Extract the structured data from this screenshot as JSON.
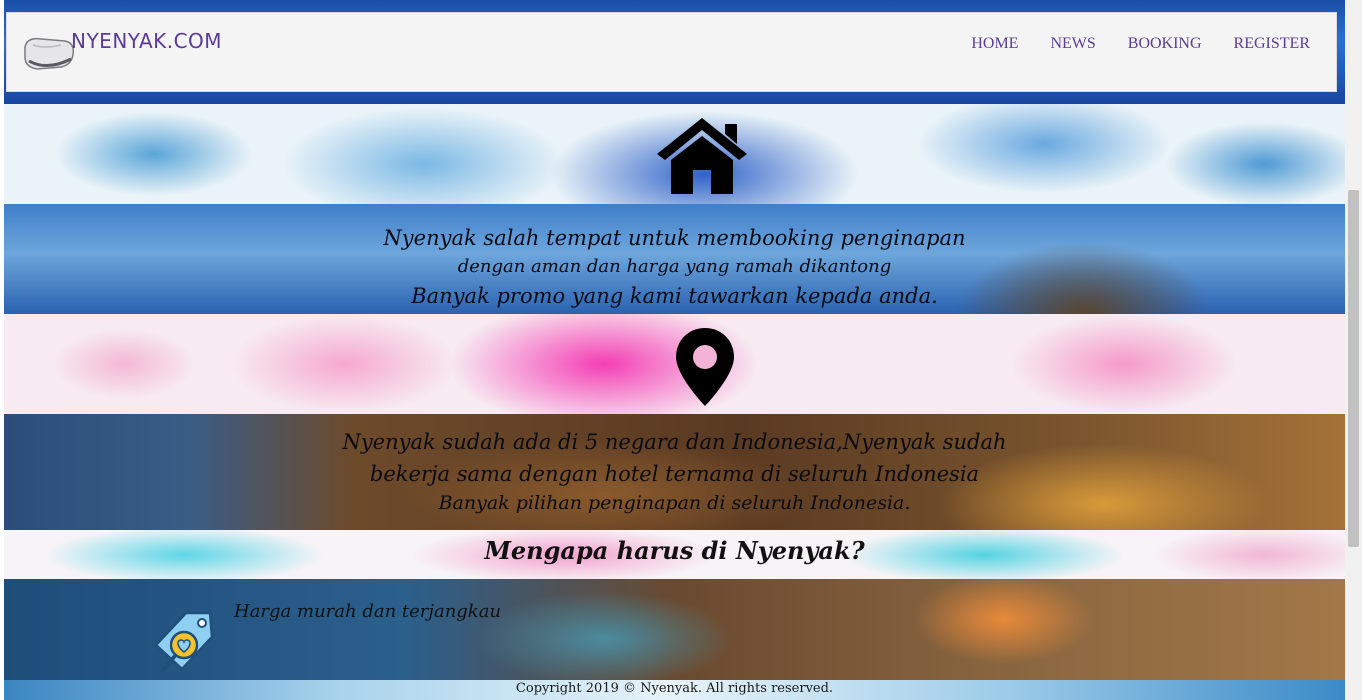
{
  "brand": {
    "name": "NYENYAK.COM"
  },
  "nav": {
    "items": [
      {
        "label": "HOME"
      },
      {
        "label": "NEWS"
      },
      {
        "label": "BOOKING"
      },
      {
        "label": "REGISTER"
      }
    ]
  },
  "intro": {
    "icon": "home-icon",
    "line1": "Nyenyak salah tempat untuk membooking penginapan",
    "line2": "dengan aman dan harga yang ramah dikantong",
    "line3": "Banyak promo yang kami tawarkan kepada anda."
  },
  "location": {
    "icon": "map-pin-icon",
    "line1": "Nyenyak sudah ada di 5 negara dan Indonesia,Nyenyak sudah",
    "line2": "bekerja sama dengan hotel ternama di seluruh Indonesia",
    "line3": "Banyak pilihan penginapan di seluruh Indonesia."
  },
  "why": {
    "title": "Mengapa harus di Nyenyak?"
  },
  "features": [
    {
      "icon": "price-tag-heart-icon",
      "text": "Harga murah dan terjangkau"
    }
  ],
  "footer": {
    "copyright": "Copyright 2019 © Nyenyak. All rights reserved."
  },
  "colors": {
    "nav_text": "#5c3d8f",
    "navbar_bg": "#f4f4f5"
  }
}
